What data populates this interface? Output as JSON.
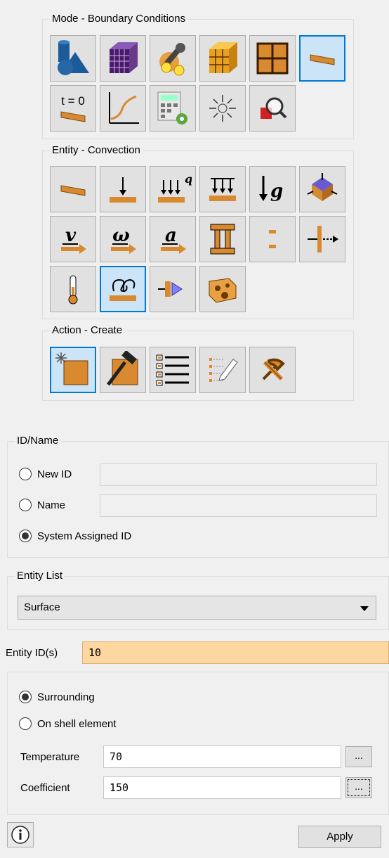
{
  "mode_group": {
    "title": "Mode - Boundary Conditions",
    "buttons": [
      {
        "icon": "geometry-icon",
        "active": false
      },
      {
        "icon": "mesh-cube-icon",
        "active": false
      },
      {
        "icon": "properties-wrench-icon",
        "active": false
      },
      {
        "icon": "element-cube-icon",
        "active": false
      },
      {
        "icon": "grid-nodes-icon",
        "active": false
      },
      {
        "icon": "boundary-conditions-icon",
        "active": true
      },
      {
        "icon": "initial-condition-icon",
        "text": "t = 0",
        "active": false
      },
      {
        "icon": "curve-graph-icon",
        "active": false
      },
      {
        "icon": "calculator-settings-icon",
        "active": false
      },
      {
        "icon": "spark-icon",
        "active": false
      },
      {
        "icon": "inspect-magnifier-icon",
        "active": false
      }
    ]
  },
  "entity_group": {
    "title": "Entity - Convection",
    "buttons": [
      {
        "icon": "plate-icon",
        "active": false
      },
      {
        "icon": "force-icon",
        "active": false
      },
      {
        "icon": "heat-flux-icon",
        "text": "q",
        "active": false
      },
      {
        "icon": "pressure-icon",
        "active": false
      },
      {
        "icon": "gravity-icon",
        "text": "g",
        "active": false
      },
      {
        "icon": "constraint-icon",
        "active": false
      },
      {
        "icon": "velocity-icon",
        "text": "v",
        "active": false
      },
      {
        "icon": "angular-velocity-icon",
        "text": "ω",
        "active": false
      },
      {
        "icon": "acceleration-icon",
        "text": "a",
        "active": false
      },
      {
        "icon": "contact-icon",
        "active": false
      },
      {
        "icon": "coupling-icon",
        "active": false
      },
      {
        "icon": "displacement-icon",
        "active": false
      },
      {
        "icon": "thermometer-icon",
        "active": false
      },
      {
        "icon": "convection-icon",
        "active": true
      },
      {
        "icon": "radiation-icon",
        "active": false
      },
      {
        "icon": "volume-heat-icon",
        "active": false
      }
    ]
  },
  "action_group": {
    "title": "Action - Create",
    "buttons": [
      {
        "icon": "create-icon",
        "active": true
      },
      {
        "icon": "modify-hammer-icon",
        "active": false
      },
      {
        "icon": "list-icon",
        "active": false
      },
      {
        "icon": "edit-list-icon",
        "active": false
      },
      {
        "icon": "delete-icon",
        "active": false
      }
    ]
  },
  "id_name": {
    "title": "ID/Name",
    "new_id_label": "New ID",
    "new_id_value": "",
    "name_label": "Name",
    "name_value": "",
    "system_label": "System Assigned ID",
    "selected": "system"
  },
  "entity_list": {
    "title": "Entity List",
    "selected": "Surface"
  },
  "entity_ids": {
    "label": "Entity ID(s)",
    "value": "10"
  },
  "convection": {
    "surrounding_label": "Surrounding",
    "shell_label": "On shell element",
    "selected": "surrounding",
    "temperature_label": "Temperature",
    "temperature_value": "70",
    "coefficient_label": "Coefficient",
    "coefficient_value": "150",
    "browse_label": "..."
  },
  "footer": {
    "info_icon": "info-icon",
    "apply_label": "Apply"
  },
  "colors": {
    "accent": "#0078d7",
    "active_bg": "#cce4f7",
    "highlight_field": "#fcd7a0",
    "orange": "#d9892b"
  }
}
